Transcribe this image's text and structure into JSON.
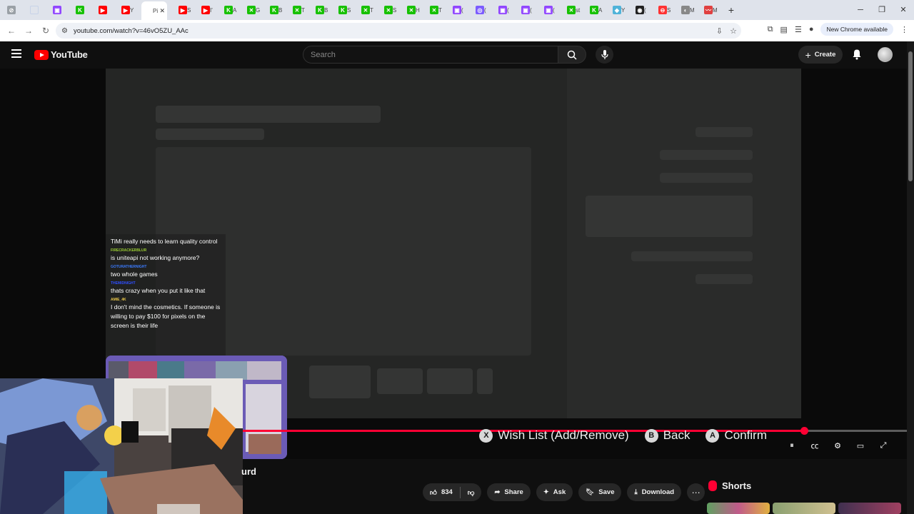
{
  "browser": {
    "tabs": [
      {
        "label": "",
        "color": "#9aa0a6",
        "glyph": "⊘"
      },
      {
        "label": "",
        "color": "#c7d3e8",
        "glyph": ""
      },
      {
        "label": "",
        "color": "#9146ff",
        "glyph": "▣"
      },
      {
        "label": "",
        "color": "#17c100",
        "glyph": "K"
      },
      {
        "label": "",
        "color": "#ff0000",
        "glyph": "▶"
      },
      {
        "label": "Y",
        "color": "#ff0000",
        "glyph": "▶"
      },
      {
        "label": "Pi",
        "color": "#ffffff",
        "glyph": "",
        "active": true
      },
      {
        "label": "S",
        "color": "#ff0000",
        "glyph": "▶"
      },
      {
        "label": "I'",
        "color": "#ff0000",
        "glyph": "▶"
      },
      {
        "label": "A",
        "color": "#17c100",
        "glyph": "K"
      },
      {
        "label": "G",
        "color": "#17c100",
        "glyph": "✕"
      },
      {
        "label": "B",
        "color": "#17c100",
        "glyph": "K"
      },
      {
        "label": "T",
        "color": "#17c100",
        "glyph": "✕"
      },
      {
        "label": "B",
        "color": "#17c100",
        "glyph": "K"
      },
      {
        "label": "S",
        "color": "#17c100",
        "glyph": "K"
      },
      {
        "label": "T",
        "color": "#17c100",
        "glyph": "✕"
      },
      {
        "label": "S",
        "color": "#17c100",
        "glyph": "✕"
      },
      {
        "label": "H",
        "color": "#17c100",
        "glyph": "✕"
      },
      {
        "label": "T",
        "color": "#17c100",
        "glyph": "✕"
      },
      {
        "label": "(",
        "color": "#9146ff",
        "glyph": "▣"
      },
      {
        "label": "(",
        "color": "#7c5cff",
        "glyph": "◎"
      },
      {
        "label": "(",
        "color": "#9146ff",
        "glyph": "▣"
      },
      {
        "label": "(",
        "color": "#9146ff",
        "glyph": "▣"
      },
      {
        "label": "(",
        "color": "#9146ff",
        "glyph": "▣"
      },
      {
        "label": "st",
        "color": "#17c100",
        "glyph": "✕"
      },
      {
        "label": "A",
        "color": "#17c100",
        "glyph": "K"
      },
      {
        "label": "Y",
        "color": "#4fb3d9",
        "glyph": "◆"
      },
      {
        "label": "(",
        "color": "#222222",
        "glyph": "◉"
      },
      {
        "label": "S",
        "color": "#ff3333",
        "glyph": "⊖"
      },
      {
        "label": "M",
        "color": "#888888",
        "glyph": "◐"
      },
      {
        "label": "M",
        "color": "#e04040",
        "glyph": "〰"
      }
    ],
    "new_tab": "+",
    "url": "youtube.com/watch?v=46vO5ZU_AAc",
    "update_chip": "New Chrome available"
  },
  "youtube": {
    "logo_text": "YouTube",
    "search_placeholder": "Search",
    "create_label": "Create"
  },
  "video": {
    "chat": [
      {
        "user": "",
        "user_color": "#cccccc",
        "text": "TiMi really needs to learn quality control"
      },
      {
        "user": "FIRECRACKERBLUR",
        "user_color": "#9acd32",
        "text": "is uniteapi not working anymore?"
      },
      {
        "user": "GOTURATHERNIGHT",
        "user_color": "#3b7bff",
        "text": "two whole games"
      },
      {
        "user": "THEMIDNIGHT",
        "user_color": "#2f4fff",
        "text": "thats crazy when you put it like that"
      },
      {
        "user": "AMIE_4K",
        "user_color": "#e8c64a",
        "text": "I don't mind the cosmetics. If someone is willing to pay $100 for pixels on the screen is their life"
      }
    ],
    "prompts": [
      {
        "button": "X",
        "label": "Wish List (Add/Remove)"
      },
      {
        "button": "B",
        "label": "Back"
      },
      {
        "button": "A",
        "label": "Confirm"
      }
    ],
    "progress": 0.845,
    "buffered": 0.9
  },
  "below": {
    "title_fragment": "urd",
    "like_count": "834",
    "share_label": "Share",
    "ask_label": "Ask",
    "save_label": "Save",
    "download_label": "Download",
    "shorts_label": "Shorts"
  }
}
